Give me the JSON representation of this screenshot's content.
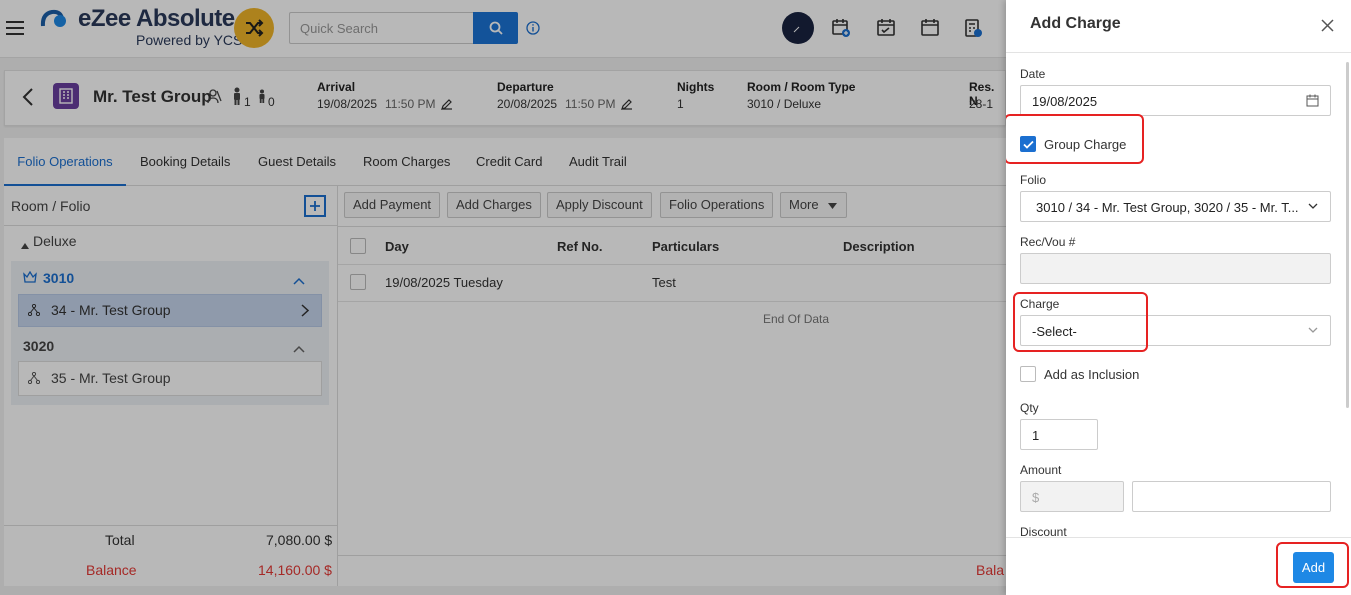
{
  "app": {
    "logo_title": "eZee Absolute",
    "logo_sub": "Powered by YCS",
    "search_placeholder": "Quick Search"
  },
  "guest": {
    "name": "Mr. Test Group",
    "adults": "1",
    "children": "0",
    "arrival_label": "Arrival",
    "arrival_date": "19/08/2025",
    "arrival_time": "11:50 PM",
    "departure_label": "Departure",
    "departure_date": "20/08/2025",
    "departure_time": "11:50 PM",
    "nights_label": "Nights",
    "nights_value": "1",
    "room_label": "Room / Room Type",
    "room_value": "3010 / Deluxe",
    "res_label": "Res. N",
    "res_value": "28-1"
  },
  "tabs": [
    "Folio Operations",
    "Booking Details",
    "Guest Details",
    "Room Charges",
    "Credit Card",
    "Audit Trail"
  ],
  "left_panel": {
    "title": "Room / Folio",
    "group": "Deluxe",
    "rooms": [
      {
        "number": "3010",
        "folio": "34 - Mr. Test Group"
      },
      {
        "number": "3020",
        "folio": "35 - Mr. Test Group"
      }
    ],
    "total_label": "Total",
    "total_value": "7,080.00 $",
    "balance_label": "Balance",
    "balance_value": "14,160.00 $"
  },
  "actions": [
    "Add Payment",
    "Add Charges",
    "Apply Discount",
    "Folio Operations",
    "More"
  ],
  "table": {
    "headers": [
      "Day",
      "Ref No.",
      "Particulars",
      "Description"
    ],
    "rows": [
      {
        "day": "19/08/2025 Tuesday",
        "ref": "",
        "particulars": "Test",
        "description": ""
      }
    ],
    "end_text": "End Of Data",
    "balance_label": "Bala"
  },
  "drawer": {
    "title": "Add Charge",
    "date_label": "Date",
    "date_value": "19/08/2025",
    "group_charge_label": "Group Charge",
    "folio_label": "Folio",
    "folio_value": "3010 / 34 - Mr. Test Group, 3020 / 35 - Mr. T...",
    "recvou_label": "Rec/Vou #",
    "charge_label": "Charge",
    "charge_value": "-Select-",
    "inclusion_label": "Add as Inclusion",
    "qty_label": "Qty",
    "qty_value": "1",
    "amount_label": "Amount",
    "currency_symbol": "$",
    "discount_label": "Discount",
    "add_button": "Add"
  }
}
